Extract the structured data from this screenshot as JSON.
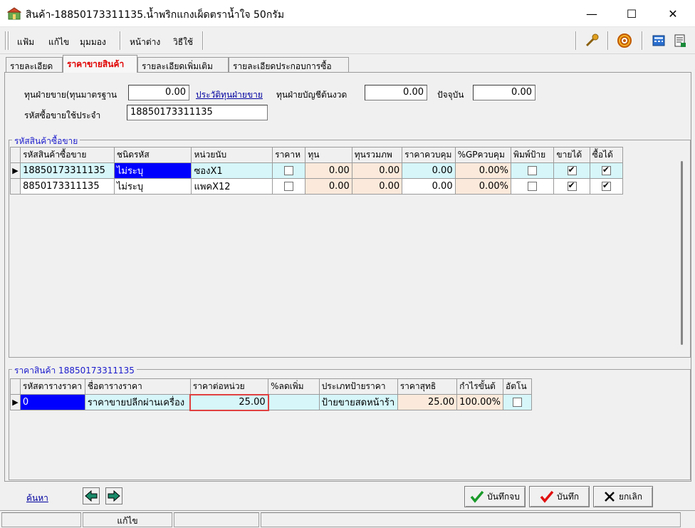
{
  "window": {
    "title": "สินค้า-18850173311135.น้ำพริกแกงเผ็ดตราน้ำใจ 50กรัม",
    "controls": [
      "–",
      "☐",
      "✕"
    ]
  },
  "menu": [
    "แฟ้ม",
    "แก้ไข",
    "มุมมอง",
    "หน้าต่าง",
    "วิธีใช้"
  ],
  "tabs": [
    "รายละเอียด",
    "ราคาขายสินค้า",
    "รายละเอียดเพิ่มเติม",
    "รายละเอียดประกอบการซื้อ"
  ],
  "form": {
    "std_cost_label": "ทุนฝ่ายขาย(ทุนมาตรฐาน",
    "std_cost_value": "0.00",
    "cost_history_link": "ประวัติทุนฝ่ายขาย",
    "acct_cost_label": "ทุนฝ่ายบัญชีต้นงวด",
    "acct_cost_value": "0.00",
    "current_label": "ปัจจุบัน",
    "current_value": "0.00",
    "default_code_label": "รหัสซื้อขายใช้ประจำ",
    "default_code_value": "18850173311135"
  },
  "sku_group": {
    "title": "รหัสสินค้าซื้อขาย",
    "columns": [
      "รหัสสินค้าซื้อขาย",
      "ชนิดรหัส",
      "หน่วยนับ",
      "ราคาห",
      "ทุน",
      "ทุนรวมภพ",
      "ราคาควบคุม",
      "%GPควบคุม",
      "พิมพ์ป้าย",
      "ขายได้",
      "ซื้อได้"
    ],
    "rows": [
      {
        "indicator": "▶",
        "code": "18850173311135",
        "type": "ไม่ระบุ",
        "unit": "ซองX1",
        "cost": "0.00",
        "cost_vat": "0.00",
        "ctrl_price": "0.00",
        "gp": "0.00%"
      },
      {
        "indicator": "",
        "code": "8850173311135",
        "type": "ไม่ระบุ",
        "unit": "แพคX12",
        "cost": "0.00",
        "cost_vat": "0.00",
        "ctrl_price": "0.00",
        "gp": "0.00%"
      }
    ]
  },
  "price_group": {
    "title": "ราคาสินค้า 18850173311135",
    "columns": [
      "รหัสตารางราคา",
      "ชื่อตารางราคา",
      "ราคาต่อหน่วย",
      "%ลดเพิ่ม",
      "ประเภทป้ายราคา",
      "ราคาสุทธิ",
      "กำไรขั้นต้",
      "อัตโน"
    ],
    "rows": [
      {
        "indicator": "▶",
        "code": "0",
        "name": "ราคาขายปลีกผ่านเครื่อง",
        "unit_price": "25.00",
        "discount": "",
        "label_type": "ป้ายขายสดหน้าร้า",
        "net": "25.00",
        "margin": "100.00%"
      }
    ]
  },
  "bottom": {
    "search_link": "ค้นหา",
    "save_close": "บันทึกจบ",
    "save": "บันทึก",
    "cancel": "ยกเลิก"
  },
  "status": {
    "mode": "แก้ไข"
  },
  "colors": {
    "highlight": "#e04040",
    "selection": "#0000ff",
    "cyan_cell": "#d6f6fa",
    "peach_cell": "#fbeadb"
  }
}
